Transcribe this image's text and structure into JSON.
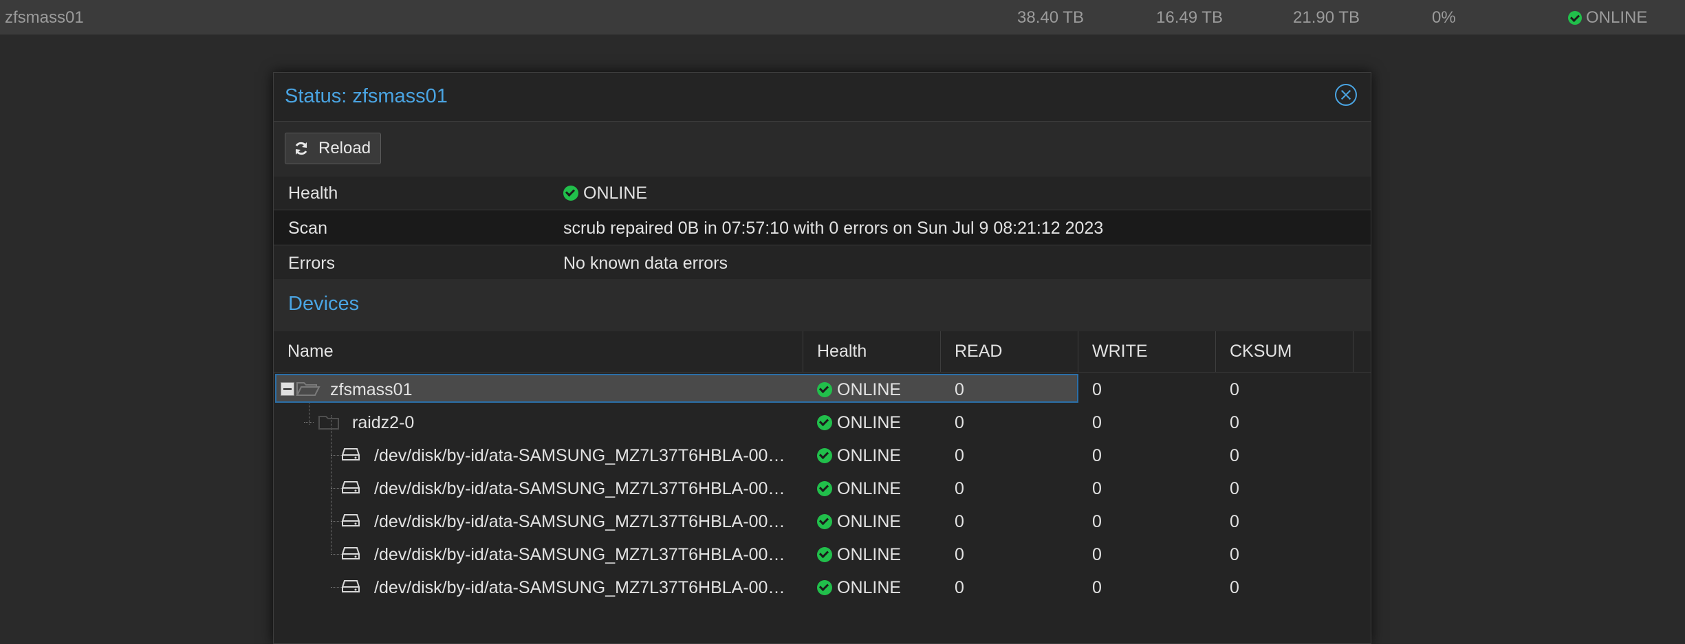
{
  "background_row": {
    "name": "zfsmass01",
    "size": "38.40 TB",
    "used": "16.49 TB",
    "free": "21.90 TB",
    "frag": "0%",
    "health": "ONLINE"
  },
  "window": {
    "title": "Status: zfsmass01",
    "reload_label": "Reload"
  },
  "properties": [
    {
      "key": "Health",
      "value": "ONLINE",
      "status": "ok"
    },
    {
      "key": "Scan",
      "value": "scrub repaired 0B in 07:57:10 with 0 errors on Sun Jul 9 08:21:12 2023"
    },
    {
      "key": "Errors",
      "value": "No known data errors"
    }
  ],
  "devices": {
    "title": "Devices",
    "columns": [
      "Name",
      "Health",
      "READ",
      "WRITE",
      "CKSUM"
    ],
    "rows": [
      {
        "name": "zfsmass01",
        "health": "ONLINE",
        "read": "0",
        "write": "0",
        "cksum": "0",
        "kind": "pool"
      },
      {
        "name": "raidz2-0",
        "health": "ONLINE",
        "read": "0",
        "write": "0",
        "cksum": "0",
        "kind": "vdev"
      },
      {
        "name": "/dev/disk/by-id/ata-SAMSUNG_MZ7L37T6HBLA-00…",
        "health": "ONLINE",
        "read": "0",
        "write": "0",
        "cksum": "0",
        "kind": "disk"
      },
      {
        "name": "/dev/disk/by-id/ata-SAMSUNG_MZ7L37T6HBLA-00…",
        "health": "ONLINE",
        "read": "0",
        "write": "0",
        "cksum": "0",
        "kind": "disk"
      },
      {
        "name": "/dev/disk/by-id/ata-SAMSUNG_MZ7L37T6HBLA-00…",
        "health": "ONLINE",
        "read": "0",
        "write": "0",
        "cksum": "0",
        "kind": "disk"
      },
      {
        "name": "/dev/disk/by-id/ata-SAMSUNG_MZ7L37T6HBLA-00…",
        "health": "ONLINE",
        "read": "0",
        "write": "0",
        "cksum": "0",
        "kind": "disk"
      },
      {
        "name": "/dev/disk/by-id/ata-SAMSUNG_MZ7L37T6HBLA-00…",
        "health": "ONLINE",
        "read": "0",
        "write": "0",
        "cksum": "0",
        "kind": "disk"
      }
    ]
  },
  "colors": {
    "accent": "#4aa4e2",
    "online": "#21bf4b",
    "selection_border": "#2b6fa8"
  }
}
